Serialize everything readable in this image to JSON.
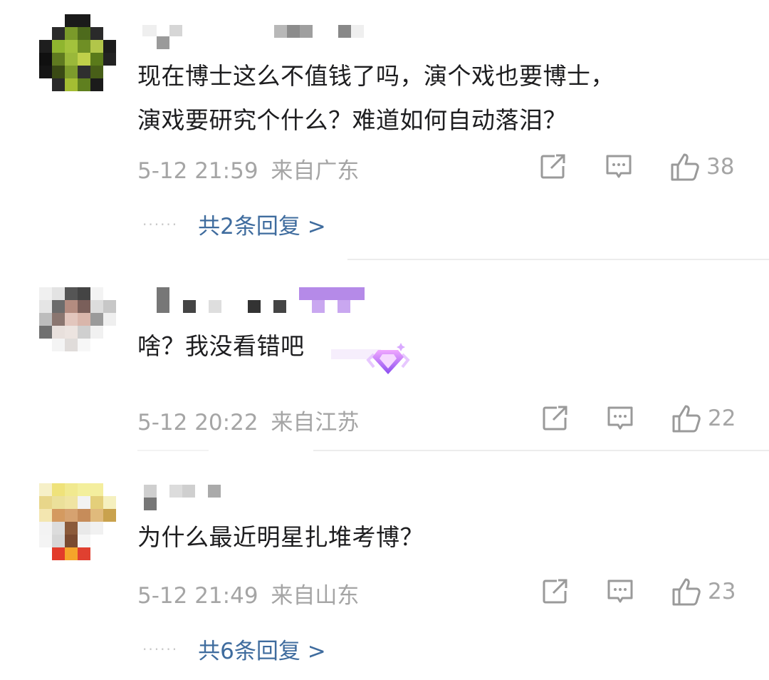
{
  "comments": [
    {
      "text": "现在博士这么不值钱了吗，演个戏也要博士，\n演戏要研究个什么？难道如何自动落泪？",
      "time": "5-12 21:59",
      "location": "来自广东",
      "likes": "38",
      "replies_label": "共2条回复 >",
      "replies_dots": "······",
      "avatar_icon": "pixelated-avatar-icon"
    },
    {
      "text": "啥？我没看错吧",
      "time": "5-12 20:22",
      "location": "来自江苏",
      "likes": "22",
      "badge_icon": "purple-gem-badge-icon",
      "avatar_icon": "pixelated-avatar-icon"
    },
    {
      "text": "为什么最近明星扎堆考博？",
      "time": "5-12 21:49",
      "location": "来自山东",
      "likes": "23",
      "replies_label": "共6条回复 >",
      "replies_dots": "······",
      "avatar_icon": "pixelated-avatar-icon"
    }
  ],
  "icons": {
    "share": "share-icon",
    "comment": "comment-icon",
    "like": "like-icon"
  },
  "colors": {
    "text": "#1d1d1f",
    "meta": "#a5a5a5",
    "link": "#3f6c9e",
    "divider": "#ececec"
  }
}
